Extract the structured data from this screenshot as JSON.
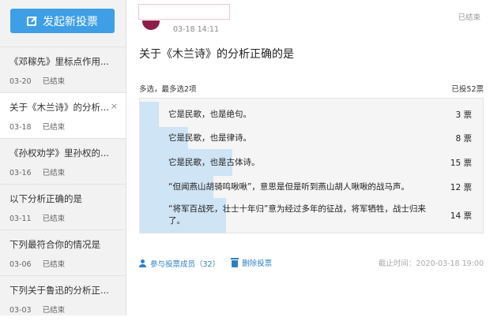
{
  "sidebar": {
    "new_vote_label": "发起新投票",
    "items": [
      {
        "title": "《邓稼先》里标点作用...",
        "date": "03-20",
        "status": "已结束"
      },
      {
        "title": "关于《木兰诗》的分析...",
        "date": "03-18",
        "status": "已结束",
        "close": "×"
      },
      {
        "title": "《孙权劝学》里孙权的...",
        "date": "03-16",
        "status": "已结束"
      },
      {
        "title": "以下分析正确的是",
        "date": "03-11",
        "status": "已结束"
      },
      {
        "title": "下列最符合你的情况是",
        "date": "03-06",
        "status": "已结束"
      },
      {
        "title": "下列关于鲁迅的分析正...",
        "date": "03-03",
        "status": "已结束"
      }
    ]
  },
  "post": {
    "time": "03-18 14:11",
    "status": "已结束",
    "question": "关于《木兰诗》的分析正确的是",
    "option_note": "多选，最多选2项",
    "total_votes": "已投52票"
  },
  "options": [
    {
      "text": "它是民歌，也是绝句。",
      "count": "3 票",
      "fraction": 0.06
    },
    {
      "text": "它是民歌，也是律诗。",
      "count": "8 票",
      "fraction": 0.15
    },
    {
      "text": "它是民歌，也是古体诗。",
      "count": "15 票",
      "fraction": 0.29
    },
    {
      "text": "“但闻燕山胡骑鸣啾啾”，意思是但是听到燕山胡人啾啾的战马声。",
      "count": "12 票",
      "fraction": 0.23
    },
    {
      "text": "“将军百战死，壮士十年归”意为经过多年的征战，将军牺牲，战士归来了。",
      "count": "14 票",
      "fraction": 0.27
    }
  ],
  "footer": {
    "members": "参与投票成员（32）",
    "delete": "删除投票",
    "deadline": "截止时间：2020-03-18 19:00"
  },
  "colors": {
    "accent": "#3e9ee6",
    "bar": "#cfe4f5",
    "link": "#2e7fc4"
  }
}
